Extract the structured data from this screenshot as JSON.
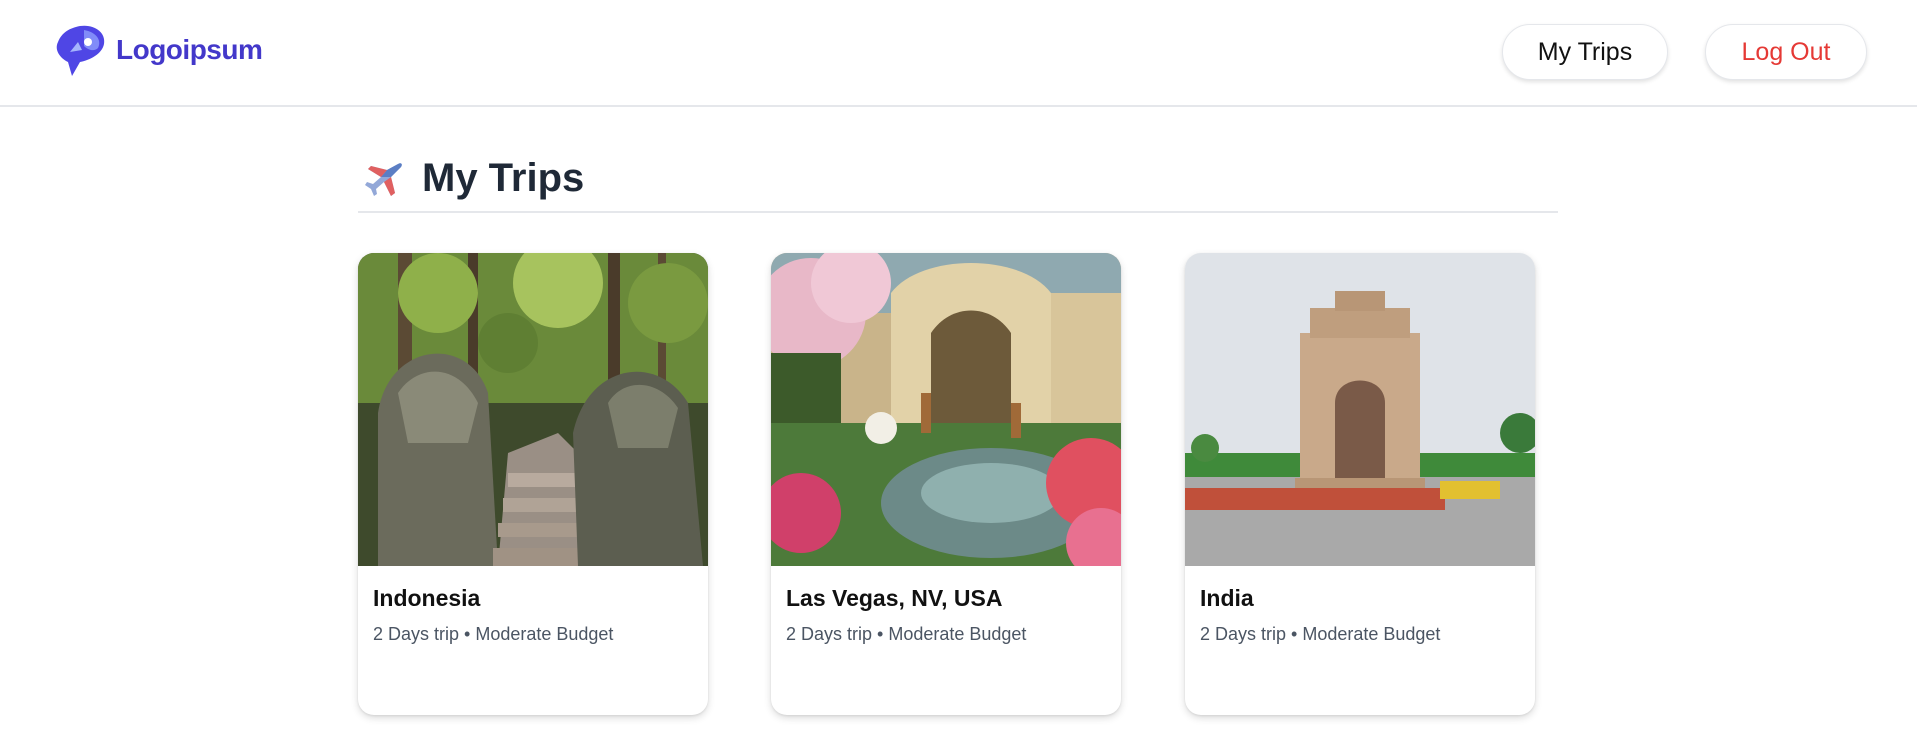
{
  "header": {
    "logo_text": "Logoipsum",
    "nav": {
      "my_trips_label": "My Trips",
      "logout_label": "Log Out"
    },
    "colors": {
      "brand": "#4338ca",
      "logout": "#e53935"
    }
  },
  "main": {
    "title": "My Trips",
    "title_icon": "airplane-icon",
    "trips": [
      {
        "destination": "Indonesia",
        "details": "2 Days trip • Moderate Budget",
        "image": "stone-dragon-statues-jungle-stairs"
      },
      {
        "destination": "Las Vegas, NV, USA",
        "details": "2 Days trip • Moderate Budget",
        "image": "conservatory-garden-fountain"
      },
      {
        "destination": "India",
        "details": "2 Days trip • Moderate Budget",
        "image": "india-gate-monument"
      }
    ]
  }
}
